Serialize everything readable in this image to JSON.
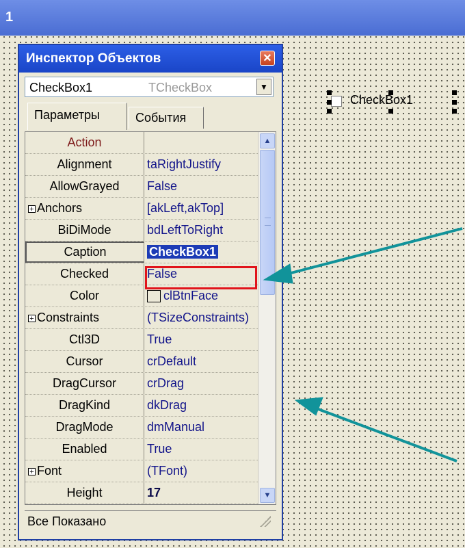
{
  "window": {
    "title_fragment": "1"
  },
  "inspector": {
    "title": "Инспектор Объектов",
    "close_glyph": "✕",
    "object_name": "CheckBox1",
    "object_type": "TCheckBox",
    "dropdown_glyph": "▼",
    "tabs": [
      {
        "label": "Параметры"
      },
      {
        "label": "События"
      }
    ],
    "properties": [
      {
        "name": "Action",
        "value": ""
      },
      {
        "name": "Alignment",
        "value": "taRightJustify"
      },
      {
        "name": "AllowGrayed",
        "value": "False"
      },
      {
        "name": "Anchors",
        "value": "[akLeft,akTop]"
      },
      {
        "name": "BiDiMode",
        "value": "bdLeftToRight"
      },
      {
        "name": "Caption",
        "value": "CheckBox1"
      },
      {
        "name": "Checked",
        "value": "False"
      },
      {
        "name": "Color",
        "value": "clBtnFace"
      },
      {
        "name": "Constraints",
        "value": "(TSizeConstraints)"
      },
      {
        "name": "Ctl3D",
        "value": "True"
      },
      {
        "name": "Cursor",
        "value": "crDefault"
      },
      {
        "name": "DragCursor",
        "value": "crDrag"
      },
      {
        "name": "DragKind",
        "value": "dkDrag"
      },
      {
        "name": "DragMode",
        "value": "dmManual"
      },
      {
        "name": "Enabled",
        "value": "True"
      },
      {
        "name": "Font",
        "value": "(TFont)"
      },
      {
        "name": "Height",
        "value": "17"
      }
    ],
    "expand_glyph": "+",
    "scroll_up_glyph": "▲",
    "scroll_down_glyph": "▼",
    "status": "Все Показано"
  },
  "design": {
    "checkbox_label": "CheckBox1"
  },
  "colors": {
    "arrow": "#11939a",
    "highlight": "#e1141b",
    "selection": "#1c3bb6"
  }
}
